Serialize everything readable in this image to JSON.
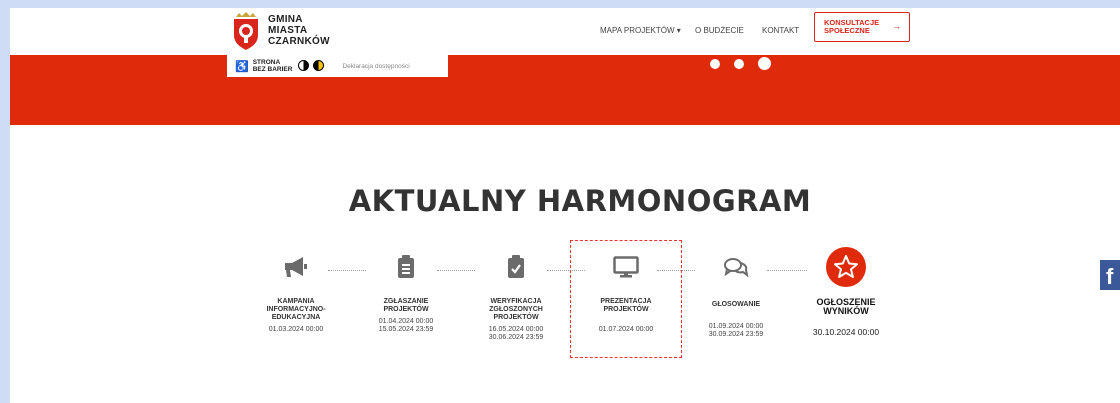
{
  "header": {
    "logo_lines": [
      "GMINA",
      "MIASTA",
      "CZARNKÓW"
    ],
    "nav": [
      "MAPA PROJEKTÓW ▾",
      "O BUDŻECIE",
      "KONTAKT"
    ],
    "cta_line1": "KONSULTACJE",
    "cta_line2": "SPOŁECZNE",
    "cta_arrow": "→"
  },
  "accessibility": {
    "label_line1": "STRONA",
    "label_line2": "BEZ BARIER",
    "declaration": "Deklaracja dostępności"
  },
  "heading": "AKTUALNY HARMONOGRAM",
  "steps": [
    {
      "title": [
        "KAMPANIA",
        "INFORMACYJNO-",
        "EDUKACYJNA"
      ],
      "dates": [
        "01.03.2024 00:00"
      ],
      "icon": "megaphone-icon"
    },
    {
      "title": [
        "ZGŁASZANIE",
        "PROJEKTÓW"
      ],
      "dates": [
        "01.04.2024 00:00",
        "15.05.2024 23:59"
      ],
      "icon": "clipboard-list-icon"
    },
    {
      "title": [
        "WERYFIKACJA",
        "ZGŁOSZONYCH",
        "PROJEKTÓW"
      ],
      "dates": [
        "16.05.2024 00:00",
        "30.06.2024 23:59"
      ],
      "icon": "clipboard-check-icon"
    },
    {
      "title": [
        "PREZENTACJA",
        "PROJEKTÓW"
      ],
      "dates": [
        "01.07.2024 00:00"
      ],
      "icon": "monitor-icon"
    },
    {
      "title": [
        "GŁOSOWANIE"
      ],
      "dates": [
        "01.09.2024 00:00",
        "30.09.2024 23:59"
      ],
      "icon": "chat-bubbles-icon"
    },
    {
      "title": [
        "OGŁOSZENIE",
        "WYNIKÓW"
      ],
      "dates": [
        "30.10.2024 00:00"
      ],
      "icon": "star-icon"
    }
  ],
  "colors": {
    "brand_red": "#df2a0c",
    "icon_gray": "#6b6b6b",
    "accent_red": "#d9261c"
  }
}
